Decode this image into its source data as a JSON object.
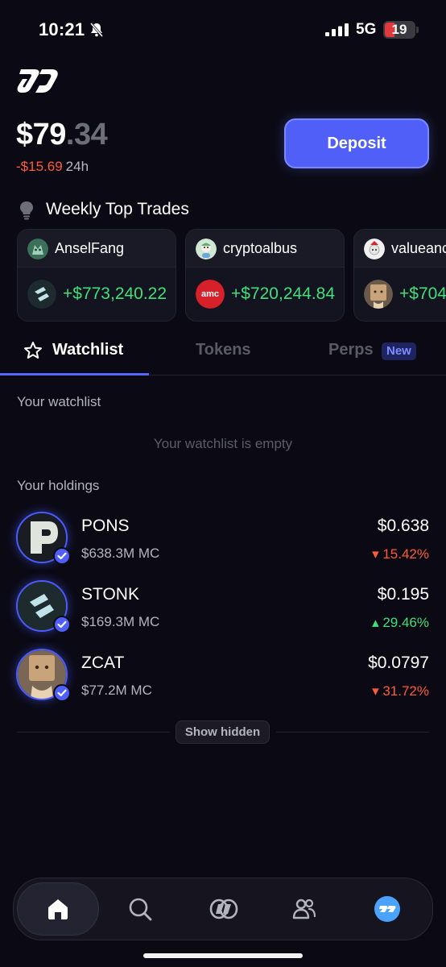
{
  "status_bar": {
    "time": "10:21",
    "network": "5G",
    "battery": "19"
  },
  "header": {
    "balance_main": "$79",
    "balance_cents": ".34",
    "change": "-$15.69",
    "period": "24h",
    "deposit_label": "Deposit"
  },
  "top_trades": {
    "title": "Weekly Top Trades",
    "cards": [
      {
        "name": "AnselFang",
        "pnl": "+$773,240.22",
        "token_icon": "stonk-icon"
      },
      {
        "name": "cryptoalbus",
        "pnl": "+$720,244.84",
        "token_icon": "amc-icon",
        "token_text": "amc"
      },
      {
        "name": "valueanc",
        "pnl": "+$704,",
        "token_icon": "zcat-icon"
      }
    ]
  },
  "tabs": {
    "watchlist": "Watchlist",
    "tokens": "Tokens",
    "perps": "Perps",
    "new_badge": "New"
  },
  "watchlist": {
    "label": "Your watchlist",
    "empty": "Your watchlist is empty"
  },
  "holdings": {
    "label": "Your holdings",
    "items": [
      {
        "symbol": "PONS",
        "mc": "$638.3M MC",
        "price": "$0.638",
        "change": "▾ 15.42%",
        "direction": "down"
      },
      {
        "symbol": "STONK",
        "mc": "$169.3M MC",
        "price": "$0.195",
        "change": "▴ 29.46%",
        "direction": "up"
      },
      {
        "symbol": "ZCAT",
        "mc": "$77.2M MC",
        "price": "$0.0797",
        "change": "▾ 31.72%",
        "direction": "down"
      }
    ]
  },
  "show_hidden": "Show hidden",
  "colors": {
    "accent": "#4f5ff7",
    "positive": "#3fe07a",
    "negative": "#ff5a3c",
    "background": "#0b0a14"
  }
}
